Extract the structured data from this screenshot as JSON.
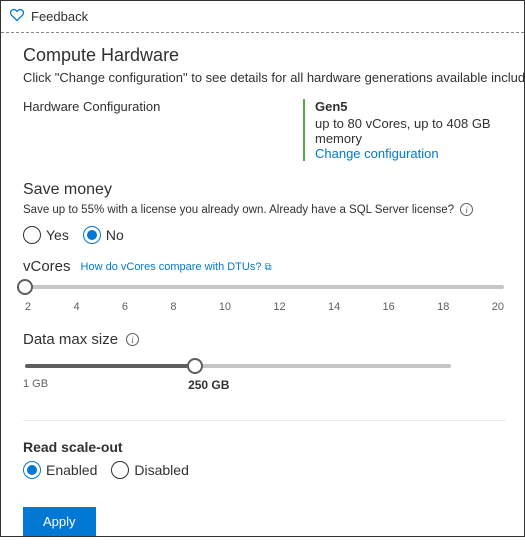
{
  "feedback": {
    "label": "Feedback"
  },
  "compute": {
    "title": "Compute Hardware",
    "desc": "Click \"Change configuration\" to see details for all hardware generations available including memo",
    "config_label": "Hardware Configuration",
    "gen": "Gen5",
    "spec": "up to 80 vCores, up to 408 GB memory",
    "change_link": "Change configuration"
  },
  "save_money": {
    "title": "Save money",
    "desc": "Save up to 55% with a license you already own. Already have a SQL Server license?",
    "yes": "Yes",
    "no": "No",
    "selected": "No"
  },
  "vcores": {
    "label": "vCores",
    "help_link": "How do vCores compare with DTUs?",
    "ticks": [
      "2",
      "4",
      "6",
      "8",
      "10",
      "12",
      "14",
      "16",
      "18",
      "20"
    ],
    "value": 2
  },
  "data_size": {
    "label": "Data max size",
    "min_label": "1 GB",
    "value_label": "250 GB",
    "fill_pct": 40
  },
  "read_scale": {
    "label": "Read scale-out",
    "enabled": "Enabled",
    "disabled": "Disabled",
    "selected": "Enabled"
  },
  "apply": {
    "label": "Apply"
  }
}
